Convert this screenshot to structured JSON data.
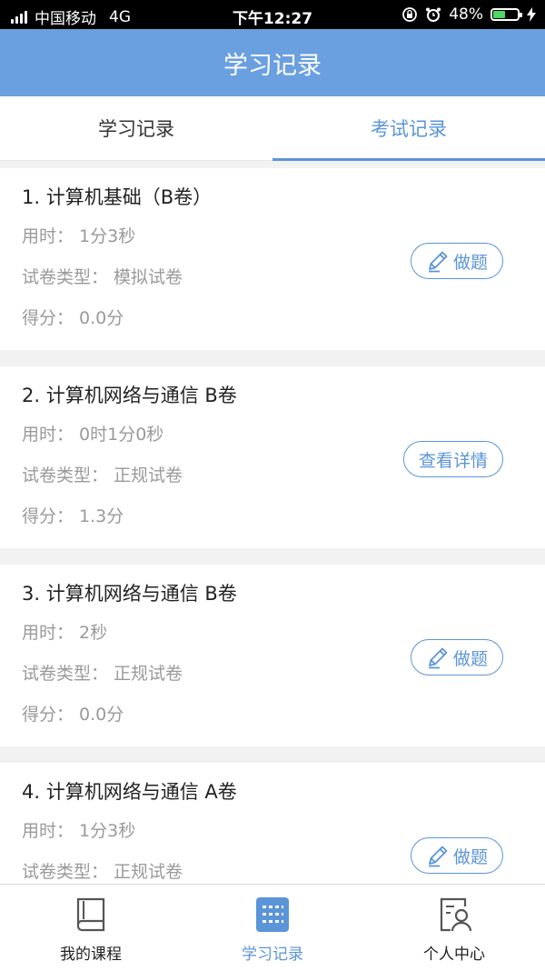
{
  "status": {
    "carrier": "中国移动",
    "network": "4G",
    "time": "下午12:27",
    "battery": "48%",
    "battery_level": 0.48
  },
  "header": {
    "title": "学习记录"
  },
  "tabs": [
    {
      "label": "学习记录",
      "active": false
    },
    {
      "label": "考试记录",
      "active": true
    }
  ],
  "records": [
    {
      "title": "1. 计算机基础（B卷）",
      "time": "用时：  1分3秒",
      "type": "试卷类型：  模拟试卷",
      "score": "得分：  0.0分",
      "action": "做题"
    },
    {
      "title": "2. 计算机网络与通信 B卷",
      "time": "用时：  0时1分0秒",
      "type": "试卷类型：  正规试卷",
      "score": "得分：  1.3分",
      "action": "查看详情"
    },
    {
      "title": "3. 计算机网络与通信 B卷",
      "time": "用时：  2秒",
      "type": "试卷类型：  正规试卷",
      "score": "得分：  0.0分",
      "action": "做题"
    },
    {
      "title": "4. 计算机网络与通信 A卷",
      "time": "用时：  1分3秒",
      "type": "试卷类型：  正规试卷",
      "score": "",
      "action": "做题"
    }
  ],
  "bottom_nav": [
    {
      "label": "我的课程",
      "icon": "book-icon",
      "active": false
    },
    {
      "label": "学习记录",
      "icon": "list-icon",
      "active": true
    },
    {
      "label": "个人中心",
      "icon": "profile-icon",
      "active": false
    }
  ],
  "colors": {
    "accent": "#5b95d8",
    "header": "#6aa0e0"
  }
}
